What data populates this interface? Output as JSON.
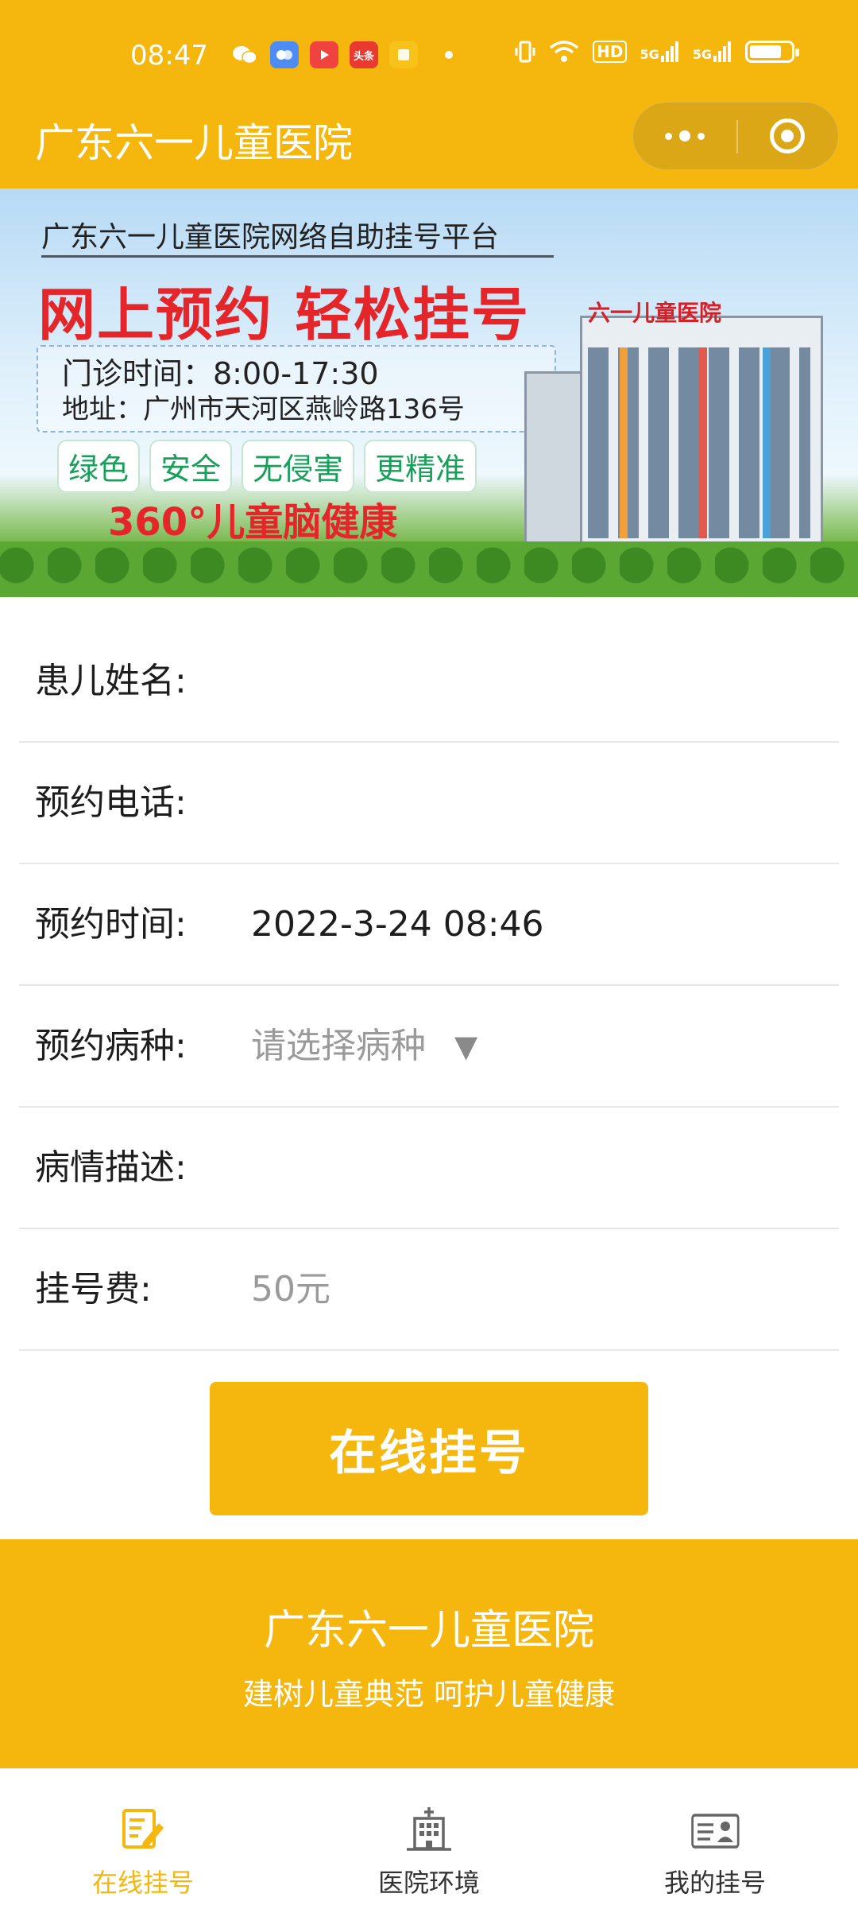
{
  "status_bar": {
    "time": "08:47",
    "network_hd": "HD",
    "network_5g_1": "5G",
    "network_5g_2": "5G",
    "apps": [
      {
        "name": "wechat-icon",
        "color": "#ffffff"
      },
      {
        "name": "chat-bubble-icon",
        "color": "#4d8cf5"
      },
      {
        "name": "video-play-icon",
        "color": "#f0423f"
      },
      {
        "name": "toutiao-icon",
        "color": "#e83a30",
        "text": "头条"
      },
      {
        "name": "notes-icon",
        "color": "#f7c21a"
      }
    ]
  },
  "header": {
    "title": "广东六一儿童医院"
  },
  "banner": {
    "subtitle": "广东六一儿童医院网络自助挂号平台",
    "headline": "网上预约 轻松挂号",
    "hours": "门诊时间：8:00-17:30",
    "address": "地址：广州市天河区燕岭路136号",
    "tags": [
      "绿色",
      "安全",
      "无侵害",
      "更精准"
    ],
    "slogan": "360°儿童脑健康",
    "building_sign": "六一儿童医院"
  },
  "form": {
    "rows": [
      {
        "label": "患儿姓名:",
        "value": ""
      },
      {
        "label": "预约电话:",
        "value": ""
      },
      {
        "label": "预约时间:",
        "value": "2022-3-24 08:46"
      },
      {
        "label": "预约病种:",
        "value": "请选择病种",
        "arrow": "▼"
      },
      {
        "label": "病情描述:",
        "value": ""
      },
      {
        "label": "挂号费:",
        "value": "50元"
      }
    ],
    "submit_label": "在线挂号"
  },
  "footer_brand": {
    "name": "广东六一儿童医院",
    "slogan": "建树儿童典范 呵护儿童健康"
  },
  "tabbar": {
    "tabs": [
      {
        "label": "在线挂号",
        "icon": "edit-form-icon",
        "active": true
      },
      {
        "label": "医院环境",
        "icon": "hospital-building-icon",
        "active": false
      },
      {
        "label": "我的挂号",
        "icon": "id-card-icon",
        "active": false
      }
    ],
    "active_color": "#f5b70d"
  },
  "colors": {
    "brand": "#f5b70d",
    "headline_red": "#e4262a",
    "placeholder_grey": "#9a9a9a"
  }
}
